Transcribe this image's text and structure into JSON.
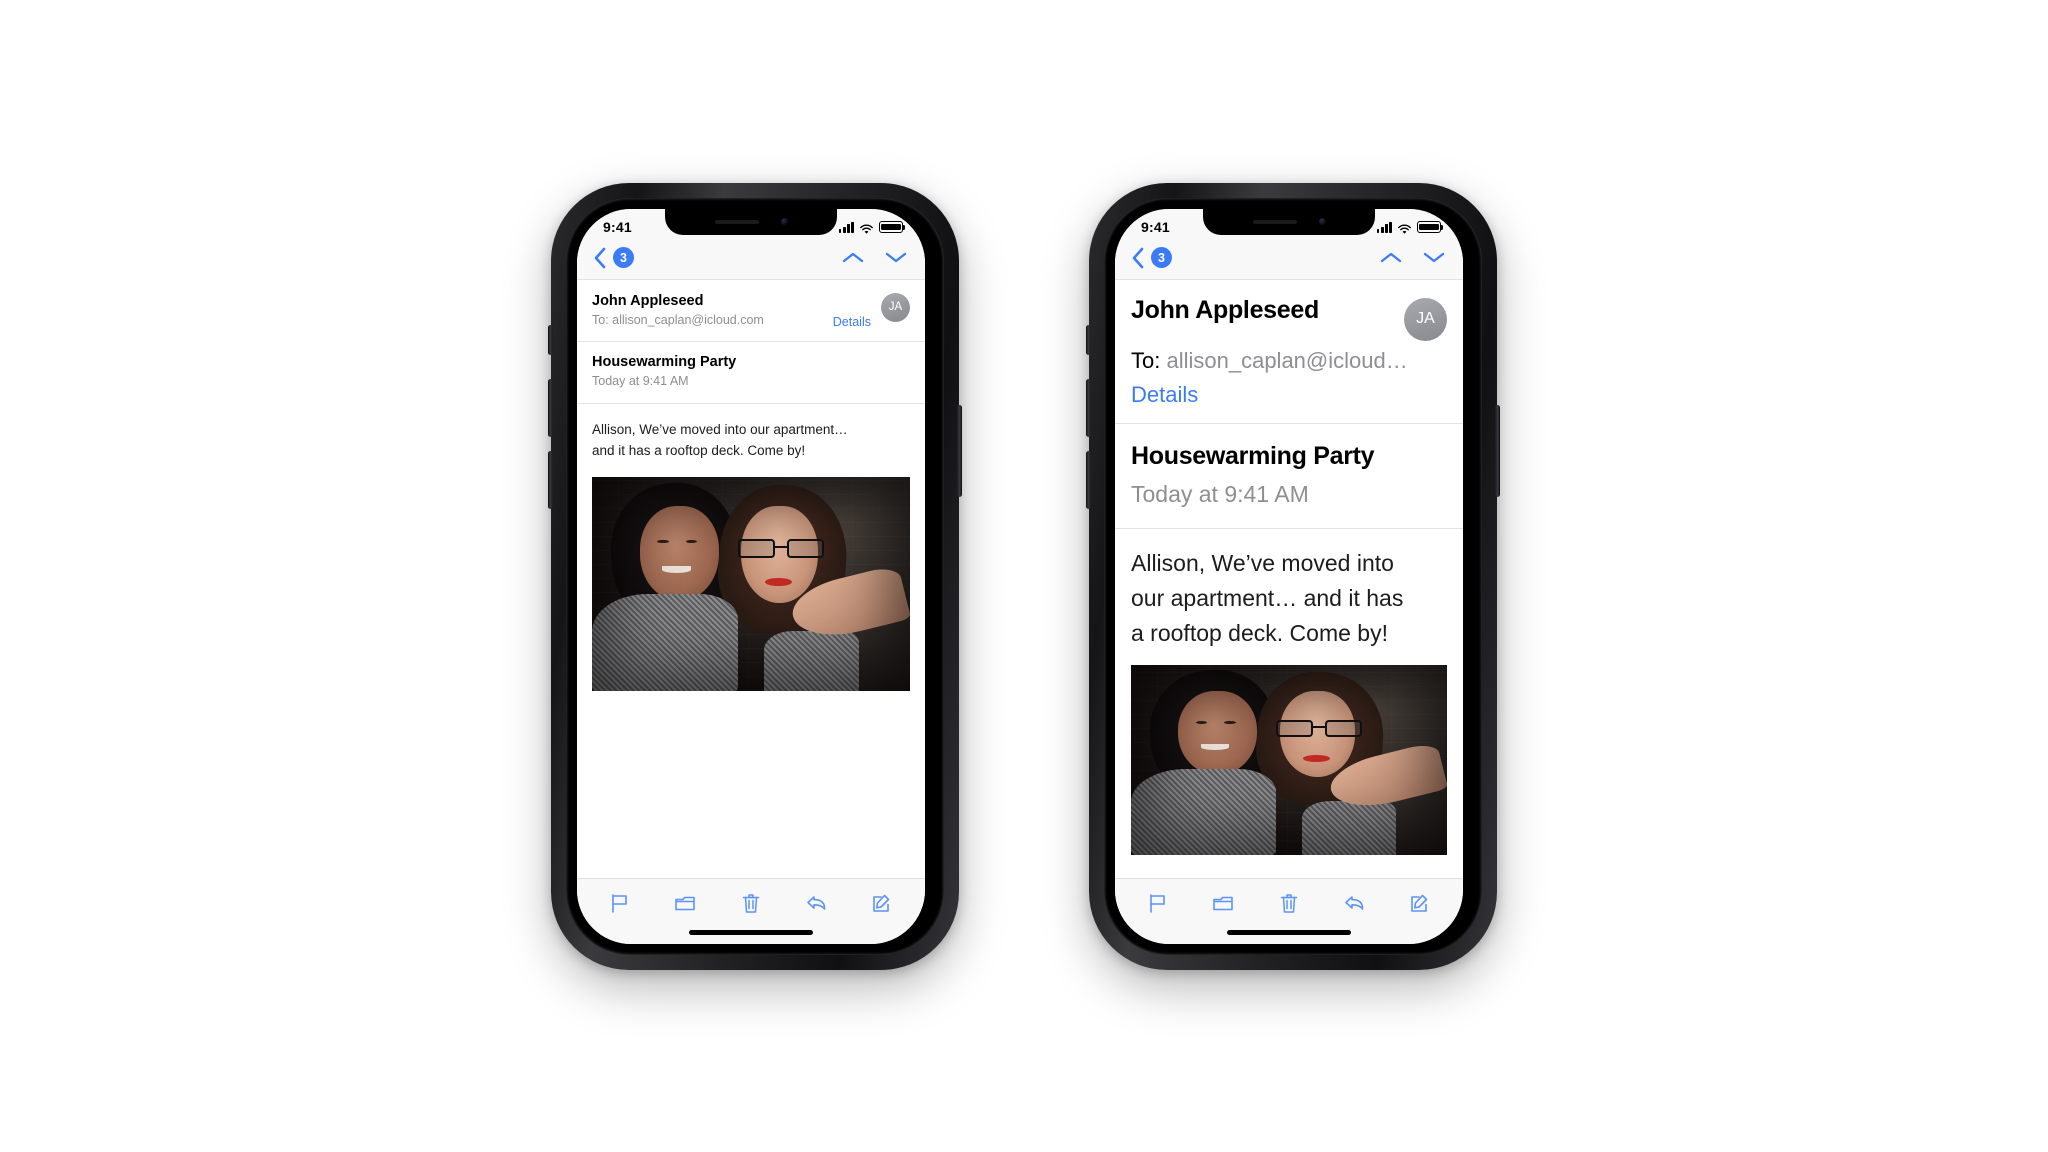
{
  "theme": {
    "accent": "#3b7cf6",
    "bg": "#ffffff",
    "chrome_bg": "#f8f8f8",
    "text_primary": "#000000",
    "text_secondary": "#8e8e93",
    "separator": "#e3e3e5",
    "avatar_bg": "#8e8f95"
  },
  "status_bar": {
    "time": "9:41",
    "cellular_icon": "signal-bars-icon",
    "wifi_icon": "wifi-icon",
    "battery_icon": "battery-icon"
  },
  "nav_bar": {
    "back_icon": "chevron-left-icon",
    "back_badge": "3",
    "previous_message_icon": "chevron-up-icon",
    "next_message_icon": "chevron-down-icon"
  },
  "message": {
    "sender": "John Appleseed",
    "to_label": "To:",
    "recipient_full": "allison_caplan@icloud.com",
    "recipient_truncated": "allison_caplan@icloud…",
    "details_label": "Details",
    "avatar_initials": "JA",
    "subject": "Housewarming Party",
    "date": "Today at 9:41 AM",
    "body_compact": "Allison, We’ve moved into our apartment… and it has a rooftop deck. Come by!",
    "body_lines_compact": [
      "Allison, We’ve moved into our apartment…",
      "and it has a rooftop deck. Come by!"
    ],
    "body_lines_large": [
      "Allison, We’ve moved into",
      "our apartment… and it has",
      "a rooftop deck. Come by!"
    ],
    "attachment_alt": "Photo of two smiling women embracing"
  },
  "toolbar": {
    "items": [
      {
        "name": "flag-icon",
        "label": "Flag"
      },
      {
        "name": "folder-icon",
        "label": "Move to Folder"
      },
      {
        "name": "trash-icon",
        "label": "Delete"
      },
      {
        "name": "reply-icon",
        "label": "Reply"
      },
      {
        "name": "compose-icon",
        "label": "Compose"
      }
    ]
  },
  "phones": [
    {
      "id": "phone-default-text",
      "text_size": "default"
    },
    {
      "id": "phone-large-text",
      "text_size": "large"
    }
  ]
}
